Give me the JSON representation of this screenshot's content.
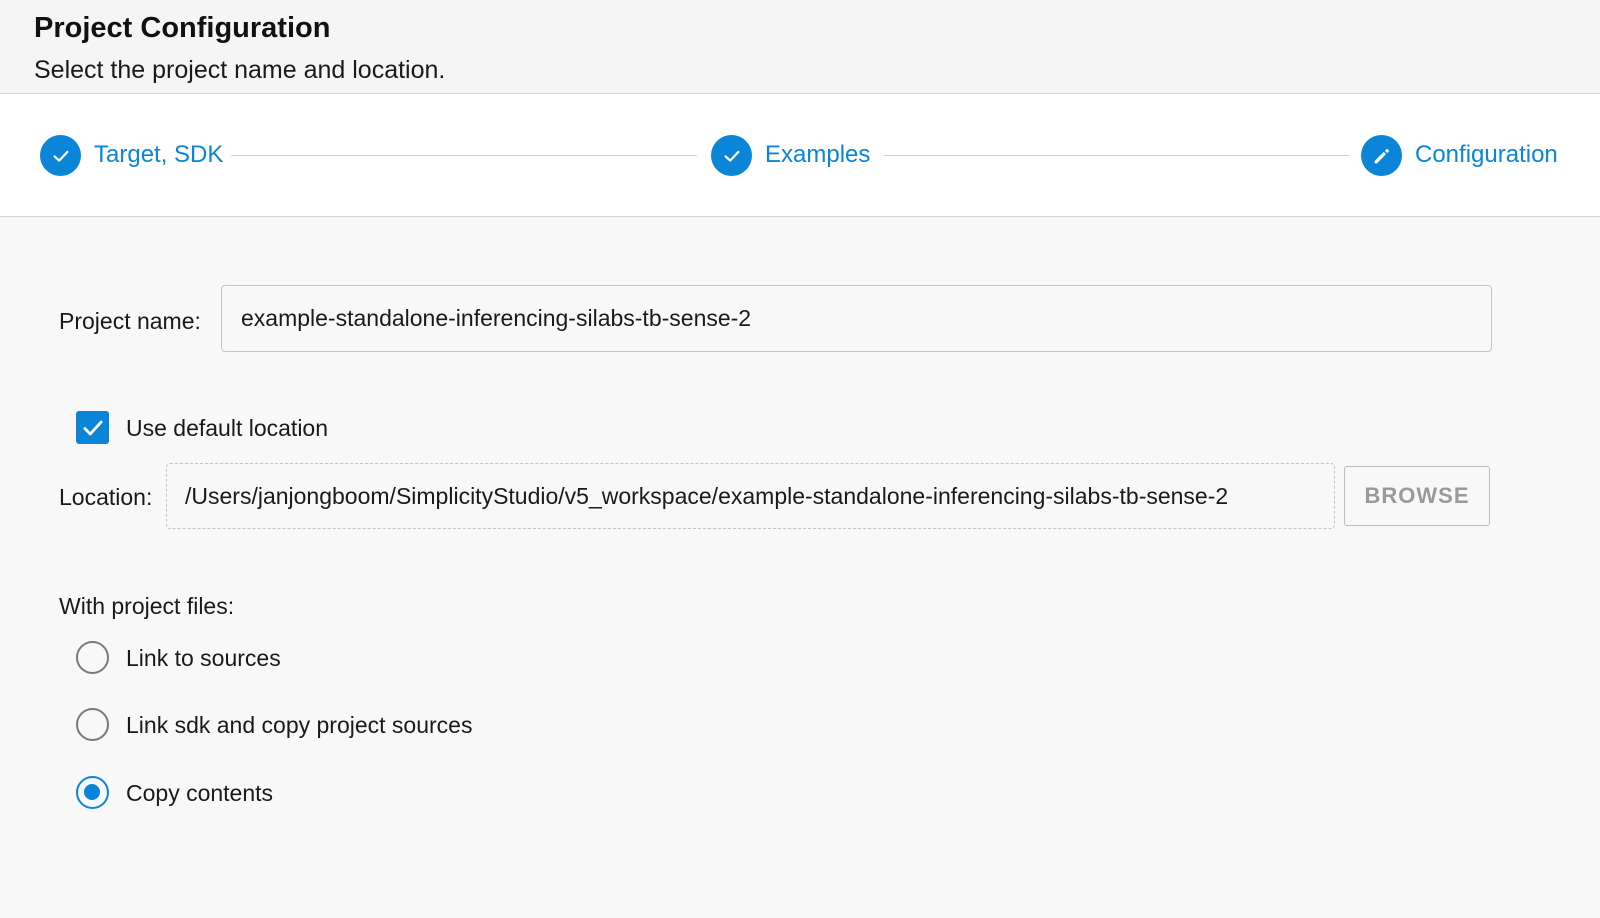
{
  "header": {
    "title": "Project Configuration",
    "subtitle": "Select the project name and location."
  },
  "stepper": {
    "steps": [
      {
        "label": "Target, SDK",
        "state": "completed",
        "icon": "check-icon"
      },
      {
        "label": "Examples",
        "state": "completed",
        "icon": "check-icon"
      },
      {
        "label": "Configuration",
        "state": "active",
        "icon": "pencil-icon"
      }
    ]
  },
  "form": {
    "project_name_label": "Project name:",
    "project_name_value": "example-standalone-inferencing-silabs-tb-sense-2",
    "use_default_location": {
      "label": "Use default location",
      "checked": true
    },
    "location_label": "Location:",
    "location_value": "/Users/janjongboom/SimplicityStudio/v5_workspace/example-standalone-inferencing-silabs-tb-sense-2",
    "browse_label": "BROWSE",
    "project_files_label": "With project files:",
    "project_files_options": [
      {
        "label": "Link to sources",
        "selected": false
      },
      {
        "label": "Link sdk and copy project sources",
        "selected": false
      },
      {
        "label": "Copy contents",
        "selected": true
      }
    ]
  },
  "colors": {
    "accent": "#0a85d8",
    "header_bg": "#f5f5f5",
    "page_bg": "#f8f8f8",
    "disabled_text": "#9a9a9a"
  }
}
